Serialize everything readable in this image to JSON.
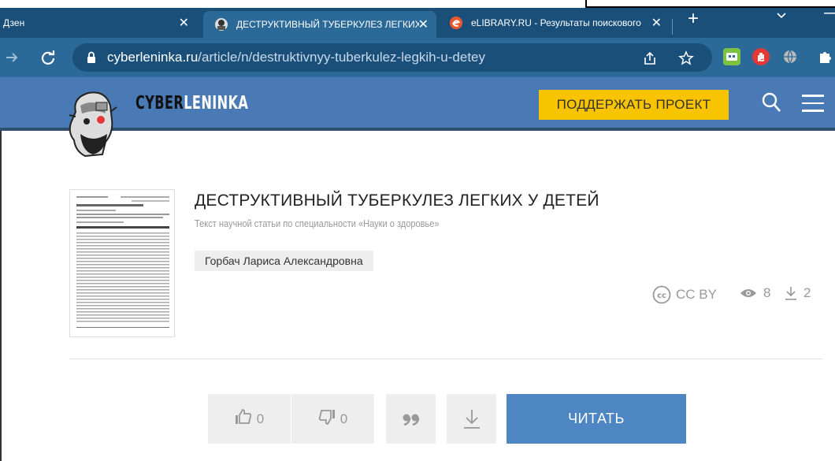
{
  "browser": {
    "tabs": [
      {
        "title": "Дзен",
        "active": false
      },
      {
        "title": "ДЕСТРУКТИВНЫЙ ТУБЕРКУЛЕЗ ЛЕГКИХ",
        "active": true
      },
      {
        "title": "eLIBRARY.RU - Результаты поискового",
        "active": false
      }
    ],
    "close_glyph": "✕",
    "new_tab_glyph": "+",
    "url_host": "cyberleninka.ru",
    "url_path": "/article/n/destruktivnyy-tuberkulez-legkih-u-detey"
  },
  "site": {
    "logo_part1": "CYBER",
    "logo_part2": "LENINKA",
    "support_label": "ПОДДЕРЖАТЬ ПРОЕКТ"
  },
  "article": {
    "title": "ДЕСТРУКТИВНЫЙ ТУБЕРКУЛЕЗ ЛЕГКИХ У ДЕТЕЙ",
    "subtitle": "Текст научной статьи по специальности «Науки о здоровье»",
    "author": "Горбач Лариса Александровна",
    "license": "CC BY",
    "views": "8",
    "downloads": "2"
  },
  "actions": {
    "likes": "0",
    "dislikes": "0",
    "read_label": "ЧИТАТЬ"
  },
  "colors": {
    "tabbar": "#1a4f7a",
    "toolbar": "#2b6a98",
    "site_header": "#4a7ab5",
    "support_button": "#f8c400",
    "read_button": "#4d86c2"
  }
}
